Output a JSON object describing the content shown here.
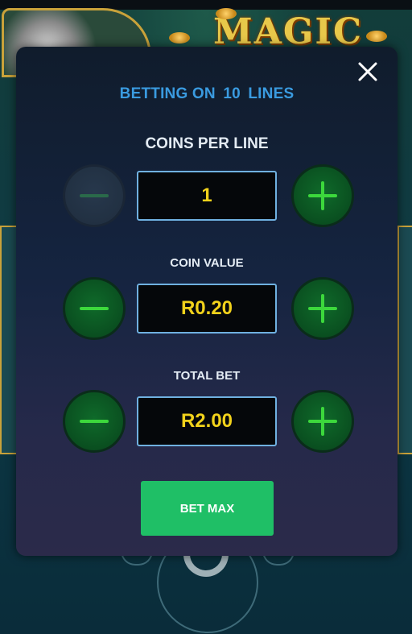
{
  "game": {
    "logo_text": "MAGIC"
  },
  "modal": {
    "close_icon": "close-icon",
    "lines": {
      "prefix": "BETTING ON",
      "count": "10",
      "suffix": "LINES"
    },
    "coins_per_line": {
      "label": "COINS PER LINE",
      "value": "1",
      "decrease_enabled": false,
      "increase_enabled": true
    },
    "coin_value": {
      "label": "COIN VALUE",
      "value": "R0.20",
      "decrease_enabled": true,
      "increase_enabled": true
    },
    "total_bet": {
      "label": "TOTAL BET",
      "value": "R2.00",
      "decrease_enabled": true,
      "increase_enabled": true
    },
    "bet_max_label": "BET MAX"
  },
  "colors": {
    "accent_blue": "#3a9be0",
    "value_yellow": "#f2d21b",
    "button_green": "#1fbf66",
    "plus_minus_green": "#3cd83c"
  }
}
